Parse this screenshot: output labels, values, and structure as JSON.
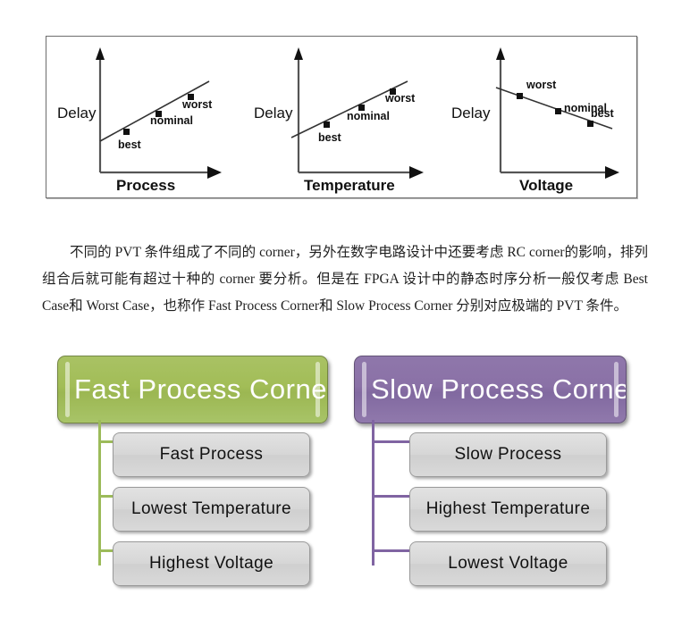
{
  "figure": {
    "axis_label_y": "Delay",
    "point_labels": {
      "best": "best",
      "nominal": "nominal",
      "worst": "worst"
    },
    "plots": [
      {
        "id": "process",
        "xlabel": "Process",
        "ylabel": "Delay",
        "trend": "increasing",
        "points": [
          {
            "label": "best",
            "x": 0.22,
            "y": 0.33
          },
          {
            "label": "nominal",
            "x": 0.5,
            "y": 0.52
          },
          {
            "label": "worst",
            "x": 0.76,
            "y": 0.71
          }
        ]
      },
      {
        "id": "temperature",
        "xlabel": "Temperature",
        "ylabel": "Delay",
        "trend": "increasing",
        "points": [
          {
            "label": "best",
            "x": 0.24,
            "y": 0.34
          },
          {
            "label": "nominal",
            "x": 0.52,
            "y": 0.53
          },
          {
            "label": "worst",
            "x": 0.78,
            "y": 0.7
          }
        ]
      },
      {
        "id": "voltage",
        "xlabel": "Voltage",
        "ylabel": "Delay",
        "trend": "decreasing",
        "points": [
          {
            "label": "worst",
            "x": 0.18,
            "y": 0.7
          },
          {
            "label": "nominal",
            "x": 0.5,
            "y": 0.55
          },
          {
            "label": "best",
            "x": 0.8,
            "y": 0.38
          }
        ]
      }
    ]
  },
  "chart_data": {
    "type": "line",
    "title": "",
    "charts": [
      {
        "type": "line",
        "title": "",
        "xlabel": "Process",
        "ylabel": "Delay",
        "x": [
          "best",
          "nominal",
          "worst"
        ],
        "values": [
          0.33,
          0.52,
          0.71
        ],
        "annotations": [
          "best",
          "nominal",
          "worst"
        ],
        "grid": false,
        "legend": "none",
        "xlim": [
          0,
          1
        ],
        "ylim": [
          0,
          1
        ],
        "note": "Delay increases with Process"
      },
      {
        "type": "line",
        "title": "",
        "xlabel": "Temperature",
        "ylabel": "Delay",
        "x": [
          "best",
          "nominal",
          "worst"
        ],
        "values": [
          0.34,
          0.53,
          0.7
        ],
        "annotations": [
          "best",
          "nominal",
          "worst"
        ],
        "grid": false,
        "legend": "none",
        "xlim": [
          0,
          1
        ],
        "ylim": [
          0,
          1
        ],
        "note": "Delay increases with Temperature"
      },
      {
        "type": "line",
        "title": "",
        "xlabel": "Voltage",
        "ylabel": "Delay",
        "x": [
          "worst",
          "nominal",
          "best"
        ],
        "values": [
          0.7,
          0.55,
          0.38
        ],
        "annotations": [
          "worst",
          "nominal",
          "best"
        ],
        "grid": false,
        "legend": "none",
        "xlim": [
          0,
          1
        ],
        "ylim": [
          0,
          1
        ],
        "note": "Delay decreases with Voltage"
      }
    ]
  },
  "paragraph": {
    "text": "不同的 PVT 条件组成了不同的 corner，另外在数字电路设计中还要考虑 RC  corner的影响，排列组合后就可能有超过十种的 corner 要分析。但是在 FPGA 设计中的静态时序分析一般仅考虑 Best  Case和 Worst  Case，也称作 Fast  Process  Corner和 Slow  Process  Corner 分别对应极端的 PVT 条件。"
  },
  "diagram": {
    "colors": {
      "fast_header": "#a2bd57",
      "slow_header": "#8a71a6",
      "fast_connector": "#9cbb5a",
      "slow_connector": "#8064a2",
      "child_box": "#d6d6d6"
    },
    "trees": [
      {
        "id": "fast",
        "header": "Fast  Process  Corner",
        "children": [
          "Fast  Process",
          "Lowest  Temperature",
          "Highest  Voltage"
        ]
      },
      {
        "id": "slow",
        "header": "Slow  Process  Corner",
        "children": [
          "Slow  Process",
          "Highest  Temperature",
          "Lowest  Voltage"
        ]
      }
    ]
  }
}
